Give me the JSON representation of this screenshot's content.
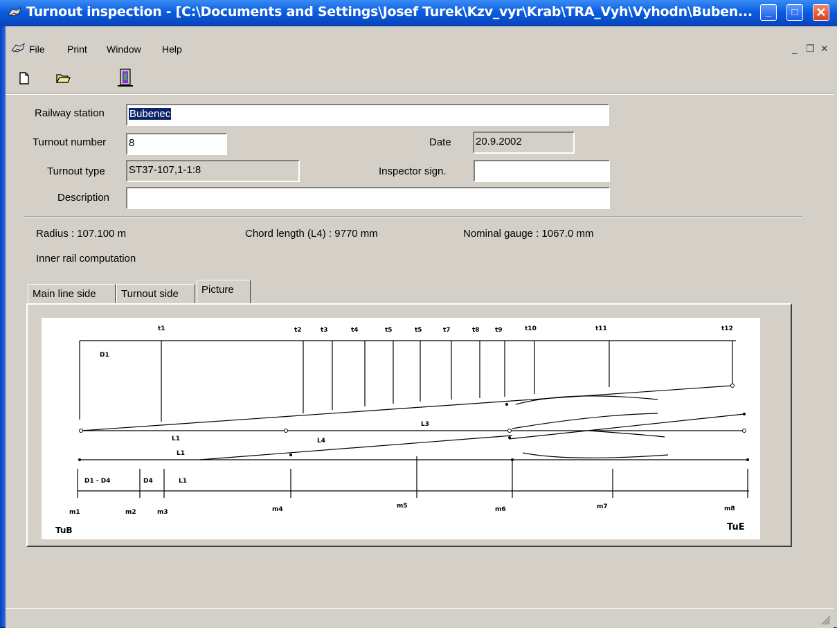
{
  "window": {
    "title": "Turnout inspection - [C:\\Documents and Settings\\Josef Turek\\Kzv_vyr\\Krab\\TRA_Vyh\\Vyhodn\\Buben...",
    "minimize_glyph": "_",
    "maximize_glyph": "□",
    "close_glyph": "✕"
  },
  "menu": {
    "items": [
      "File",
      "Print",
      "Window",
      "Help"
    ],
    "mdi_min": "_",
    "mdi_restore": "❐",
    "mdi_close": "✕"
  },
  "toolbar": {
    "icons": [
      "new-document-icon",
      "open-folder-icon",
      "exit-door-icon"
    ]
  },
  "form": {
    "railway_station_label": "Railway station",
    "railway_station_value": "Bubenec",
    "turnout_number_label": "Turnout number",
    "turnout_number_value": "8",
    "date_label": "Date",
    "date_value": "20.9.2002",
    "turnout_type_label": "Turnout type",
    "turnout_type_value": "ST37-107,1-1:8",
    "inspector_label": "Inspector sign.",
    "inspector_value": "",
    "description_label": "Description",
    "description_value": ""
  },
  "info": {
    "radius": "Radius : 107.100 m",
    "chord": "Chord length (L4) : 9770 mm",
    "gauge": "Nominal gauge : 1067.0 mm",
    "computation": "Inner rail computation"
  },
  "tabs": [
    {
      "label": "Main line side",
      "active": false
    },
    {
      "label": "Turnout side",
      "active": false
    },
    {
      "label": "Picture",
      "active": true
    }
  ],
  "diagram": {
    "t_labels": [
      "t1",
      "t2",
      "t3",
      "t4",
      "t5",
      "t5",
      "t7",
      "t8",
      "t9",
      "t10",
      "t11",
      "t12"
    ],
    "m_labels": [
      "m1",
      "m2",
      "m3",
      "m4",
      "m5",
      "m6",
      "m7",
      "m8"
    ],
    "segment_labels": [
      "D1",
      "L3",
      "L1",
      "L4",
      "L1",
      "D1 - D4",
      "D4",
      "L1"
    ],
    "start_label": "TuB",
    "end_label": "TuE"
  },
  "colors": {
    "title_blue": "#0a5ee0",
    "selection": "#0a246a",
    "face": "#d4d0c8"
  }
}
